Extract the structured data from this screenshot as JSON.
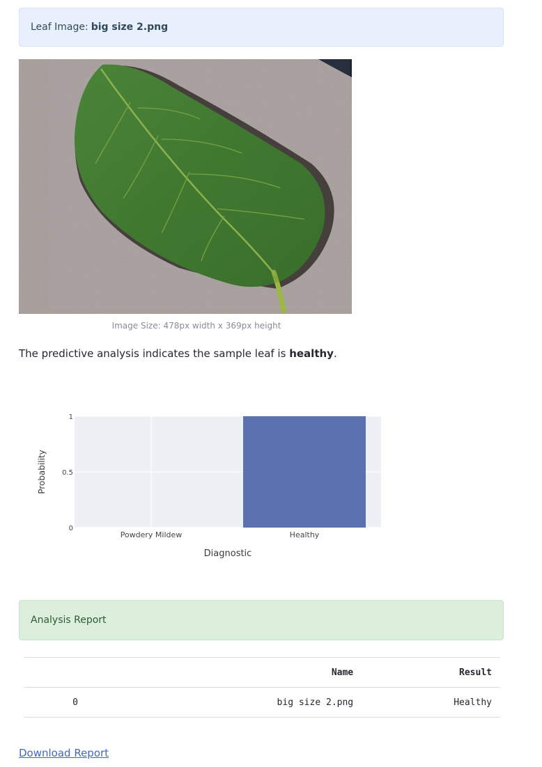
{
  "info": {
    "prefix": "Leaf Image:",
    "filename": "big size 2.png"
  },
  "image": {
    "caption": "Image Size: 478px width x 369px height"
  },
  "prediction": {
    "text_before": "The predictive analysis indicates the sample leaf is",
    "result": "healthy",
    "text_after": "."
  },
  "chart_data": {
    "type": "bar",
    "categories": [
      "Powdery Mildew",
      "Healthy"
    ],
    "values": [
      0,
      1
    ],
    "xlabel": "Diagnostic",
    "ylabel": "Probability",
    "ylim": [
      0,
      1
    ],
    "yticks": [
      "0",
      "0.5",
      "1"
    ],
    "bar_color": "#5b72ae",
    "grid": true,
    "plot_bg": "#eef0f5"
  },
  "report": {
    "title": "Analysis Report",
    "columns": [
      "",
      "Name",
      "Result"
    ],
    "rows": [
      {
        "index": "0",
        "name": "big size 2.png",
        "result": "Healthy"
      }
    ]
  },
  "download": {
    "label": "Download Report"
  },
  "colors": {
    "info_bg": "#e8f1fb",
    "success_bg": "#dcefdc",
    "link": "#4169b8"
  }
}
